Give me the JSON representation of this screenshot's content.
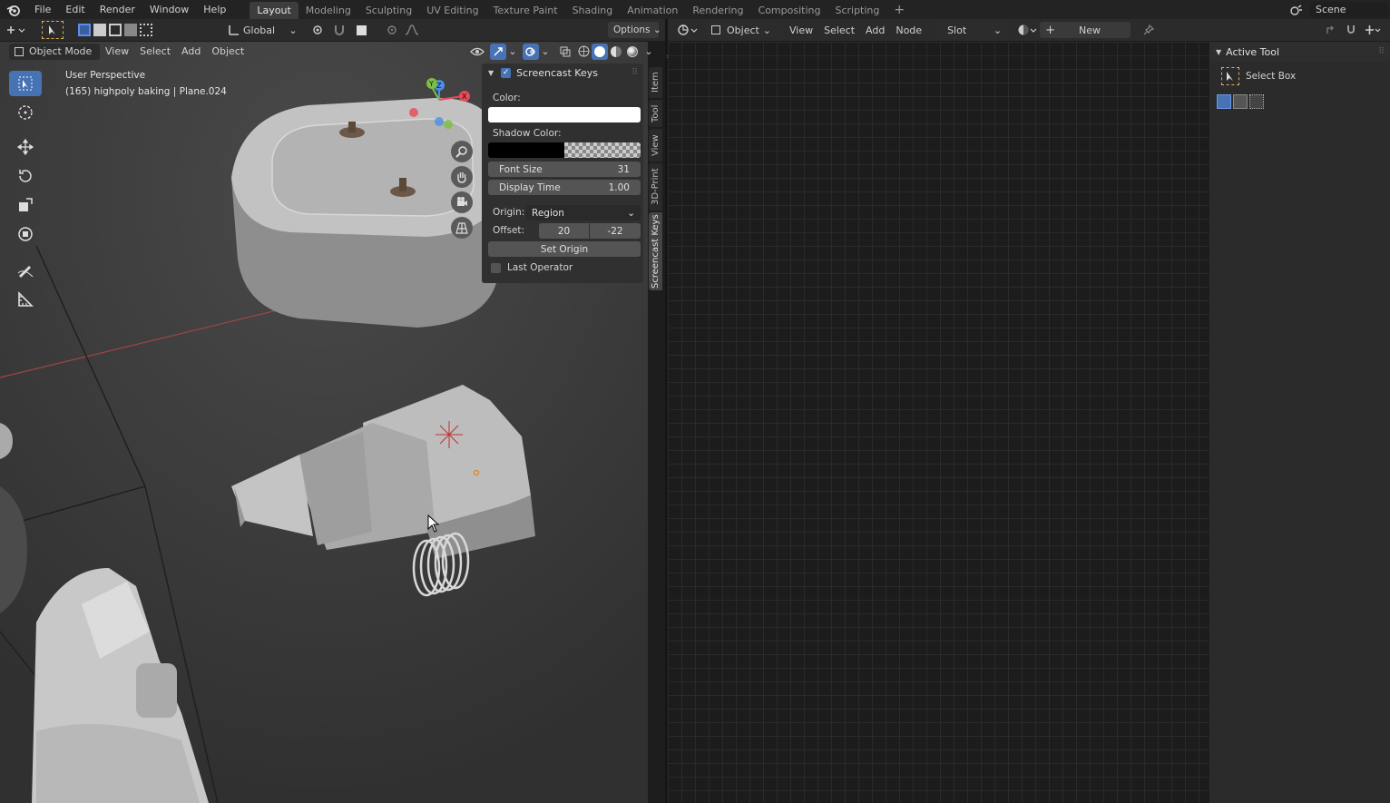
{
  "top_menu": [
    "File",
    "Edit",
    "Render",
    "Window",
    "Help"
  ],
  "workspaces": [
    {
      "label": "Layout",
      "active": true
    },
    {
      "label": "Modeling",
      "active": false
    },
    {
      "label": "Sculpting",
      "active": false
    },
    {
      "label": "UV Editing",
      "active": false
    },
    {
      "label": "Texture Paint",
      "active": false
    },
    {
      "label": "Shading",
      "active": false
    },
    {
      "label": "Animation",
      "active": false
    },
    {
      "label": "Rendering",
      "active": false
    },
    {
      "label": "Compositing",
      "active": false
    },
    {
      "label": "Scripting",
      "active": false
    }
  ],
  "add_workspace": "+",
  "scene_name": "Scene",
  "viewport_header": {
    "transform_orientation": "Global",
    "options_label": "Options",
    "mode": "Object Mode",
    "menus": [
      "View",
      "Select",
      "Add",
      "Object"
    ]
  },
  "viewport_overlay": {
    "perspective": "User Perspective",
    "info": "(165) highpoly baking | Plane.024"
  },
  "gizmo_axes": {
    "y": "Y",
    "z": "Z",
    "x": "X"
  },
  "screencast_panel": {
    "title": "Screencast Keys",
    "enabled": true,
    "color_label": "Color:",
    "color_value": "#ffffff",
    "shadow_color_label": "Shadow Color:",
    "font_size_label": "Font Size",
    "font_size_value": "31",
    "display_time_label": "Display Time",
    "display_time_value": "1.00",
    "origin_label": "Origin:",
    "origin_value": "Region",
    "offset_label": "Offset:",
    "offset_x": "20",
    "offset_y": "-22",
    "set_origin_label": "Set Origin",
    "last_operator_label": "Last Operator",
    "last_operator_checked": false
  },
  "side_tabs": [
    "Item",
    "Tool",
    "View",
    "3D-Print",
    "Screencast Keys"
  ],
  "node_header": {
    "object_label": "Object",
    "menus": [
      "View",
      "Select",
      "Add",
      "Node"
    ],
    "slot_label": "Slot",
    "new_label": "New"
  },
  "active_tool": {
    "title": "Active Tool",
    "tool_name": "Select Box"
  }
}
